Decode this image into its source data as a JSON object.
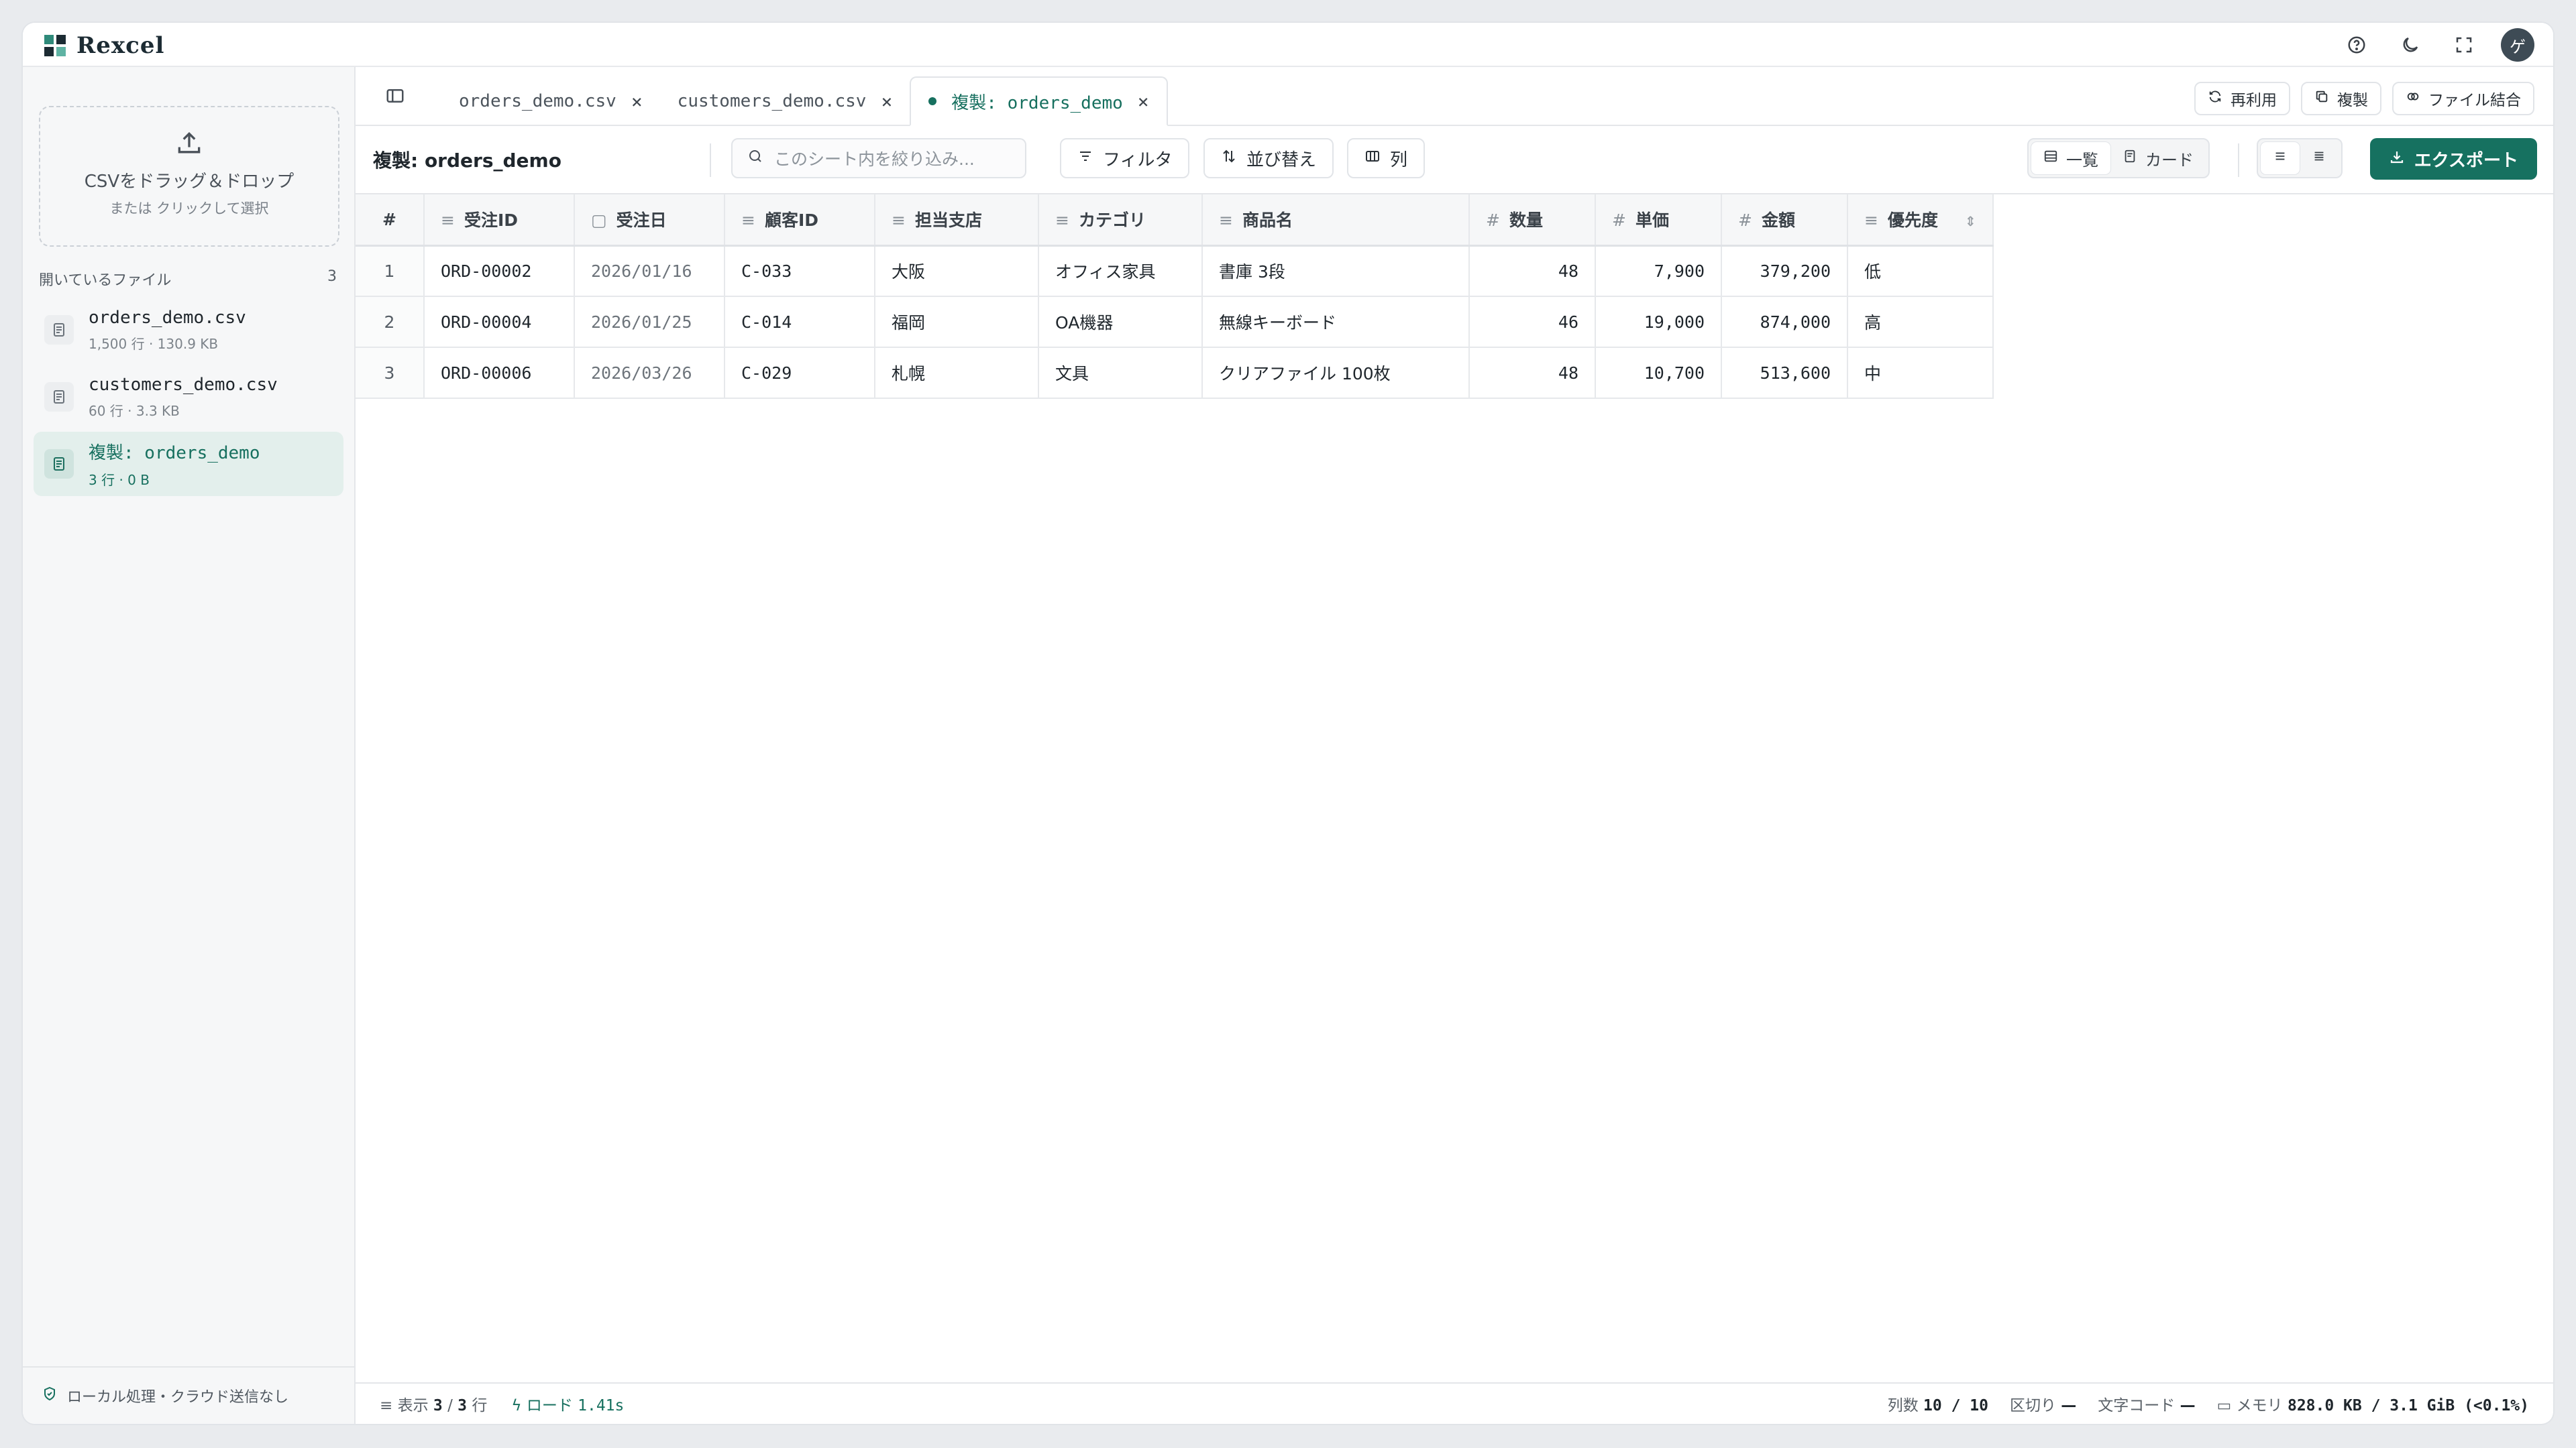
{
  "app": {
    "name": "Rexcel"
  },
  "topbar": {
    "avatar_initial": "ゲ"
  },
  "sidebar": {
    "drop_title": "CSVをドラッグ＆ドロップ",
    "drop_sub": "または クリックして選択",
    "files_heading": "開いているファイル",
    "files_count": "3",
    "files": [
      {
        "name": "orders_demo.csv",
        "meta": "1,500 行 · 130.9 KB"
      },
      {
        "name": "customers_demo.csv",
        "meta": "60 行 · 3.3 KB"
      },
      {
        "name": "複製: orders_demo",
        "meta": "3 行 · 0 B"
      }
    ],
    "footer": "ローカル処理・クラウド送信なし"
  },
  "tabs": [
    {
      "label": "orders_demo.csv"
    },
    {
      "label": "customers_demo.csv"
    },
    {
      "label": "複製: orders_demo"
    }
  ],
  "tab_actions": {
    "reuse": "再利用",
    "duplicate": "複製",
    "merge": "ファイル結合"
  },
  "toolbar": {
    "sheet_title": "複製: orders_demo",
    "search_placeholder": "このシート内を絞り込み...",
    "filter": "フィルタ",
    "sort": "並び替え",
    "columns": "列",
    "view_list": "一覧",
    "view_card": "カード",
    "export": "エクスポート"
  },
  "table": {
    "row_number_header": "#",
    "headers": [
      "受注ID",
      "受注日",
      "顧客ID",
      "担当支店",
      "カテゴリ",
      "商品名",
      "数量",
      "単価",
      "金額",
      "優先度"
    ],
    "rows": [
      [
        "1",
        "ORD-00002",
        "2026/01/16",
        "C-033",
        "大阪",
        "オフィス家具",
        "書庫 3段",
        "48",
        "7,900",
        "379,200",
        "低"
      ],
      [
        "2",
        "ORD-00004",
        "2026/01/25",
        "C-014",
        "福岡",
        "OA機器",
        "無線キーボード",
        "46",
        "19,000",
        "874,000",
        "高"
      ],
      [
        "3",
        "ORD-00006",
        "2026/03/26",
        "C-029",
        "札幌",
        "文具",
        "クリアファイル 100枚",
        "48",
        "10,700",
        "513,600",
        "中"
      ]
    ]
  },
  "status": {
    "display_label": "表示",
    "shown": "3",
    "total": "3",
    "rows_unit": "行",
    "load_label": "ロード",
    "load_time": "1.41s",
    "columns_label": "列数",
    "columns_value": "10 / 10",
    "delimiter_label": "区切り",
    "delimiter_value": "—",
    "encoding_label": "文字コード",
    "encoding_value": "—",
    "memory_label": "メモリ",
    "memory_value": "828.0 KB / 3.1 GiB (<0.1%)"
  }
}
